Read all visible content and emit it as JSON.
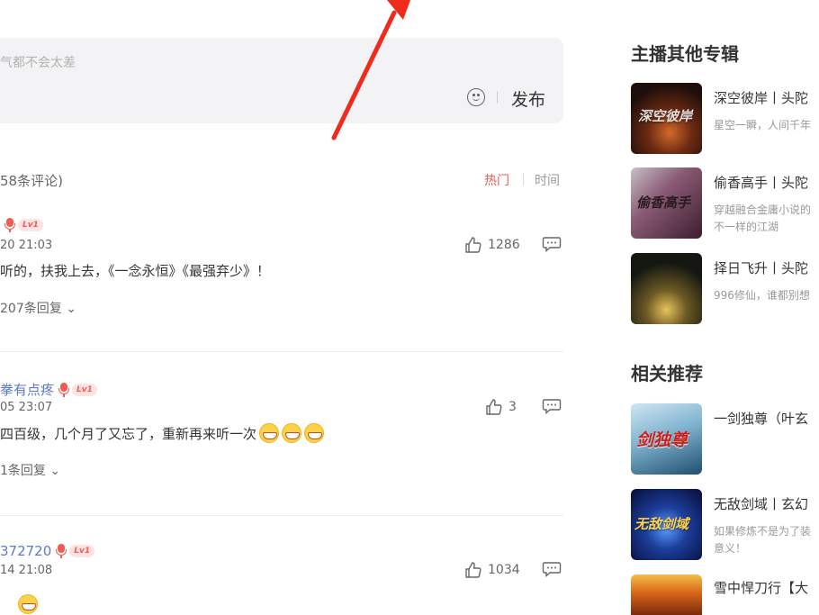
{
  "comment_box": {
    "placeholder": "气都不会太差",
    "publish_label": "发布"
  },
  "list_header": {
    "count_label": "58条评论)",
    "sort_hot": "热门",
    "sort_time": "时间"
  },
  "comments": [
    {
      "user": "",
      "level": "Lv1",
      "time": "20 21:03",
      "likes": "1286",
      "text": "听的，扶我上去，《一念永恒》《最强弃少》！",
      "replies": "207条回复"
    },
    {
      "user": "拳有点疼",
      "level": "Lv1",
      "time": "05 23:07",
      "likes": "3",
      "text": "四百级，几个月了又忘了，重新再来听一次",
      "replies": "1条回复"
    },
    {
      "user": "372720",
      "level": "Lv1",
      "time": "14 21:08",
      "likes": "1034",
      "text": "",
      "replies": ""
    }
  ],
  "sidebar": {
    "other_albums_title": "主播其他专辑",
    "other_albums": [
      {
        "title": "深空彼岸丨头陀",
        "desc_line1": "星空一瞬，人间千年",
        "desc_line2": "",
        "cover_text": "深空彼岸",
        "icon": "space-cover"
      },
      {
        "title": "偷香高手丨头陀",
        "desc_line1": "穿越融合金庸小说的",
        "desc_line2": "不一样的江湖",
        "cover_text": "偷香高手",
        "icon": "wuxia-cover"
      },
      {
        "title": "择日飞升丨头陀",
        "desc_line1": "996修仙，谁都别想",
        "desc_line2": "",
        "cover_text": "",
        "icon": "ascension-cover"
      }
    ],
    "related_title": "相关推荐",
    "related": [
      {
        "title": "一剑独尊（叶玄",
        "desc_line1": "",
        "desc_line2": "",
        "cover_text": "剑独尊",
        "icon": "sword-cover"
      },
      {
        "title": "无敌剑域丨玄幻",
        "desc_line1": "如果修炼不是为了装",
        "desc_line2": "意义！",
        "cover_text": "无敌剑域",
        "icon": "sword-domain-cover"
      },
      {
        "title": "雪中悍刀行【大",
        "desc_line1": "",
        "desc_line2": "",
        "cover_text": "",
        "icon": "snow-blade-cover"
      }
    ]
  },
  "colors": {
    "accent_red": "#f15b50",
    "username_blue": "#5f78c8",
    "input_bg": "#f3f3f5"
  }
}
